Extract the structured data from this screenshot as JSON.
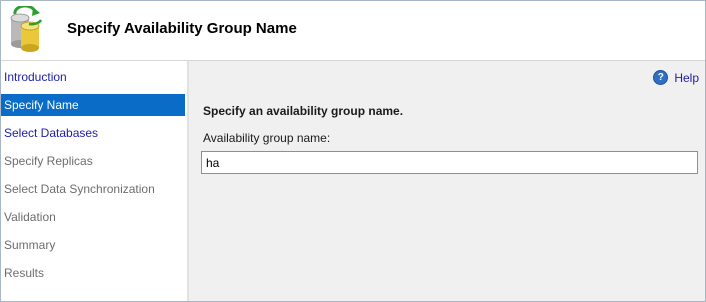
{
  "header": {
    "title": "Specify Availability Group Name",
    "icon": "database-refresh-icon"
  },
  "sidebar": {
    "items": [
      {
        "label": "Introduction",
        "state": "link"
      },
      {
        "label": "Specify Name",
        "state": "active"
      },
      {
        "label": "Select Databases",
        "state": "link"
      },
      {
        "label": "Specify Replicas",
        "state": "disabled"
      },
      {
        "label": "Select Data Synchronization",
        "state": "disabled"
      },
      {
        "label": "Validation",
        "state": "disabled"
      },
      {
        "label": "Summary",
        "state": "disabled"
      },
      {
        "label": "Results",
        "state": "disabled"
      }
    ]
  },
  "help": {
    "label": "Help",
    "icon": "help-icon"
  },
  "main": {
    "instruction": "Specify an availability group name.",
    "field_label": "Availability group name:",
    "field_value": "ha"
  },
  "colors": {
    "active_bg": "#0a6cc6",
    "link": "#1d1dab",
    "disabled": "#6d6d6d"
  }
}
